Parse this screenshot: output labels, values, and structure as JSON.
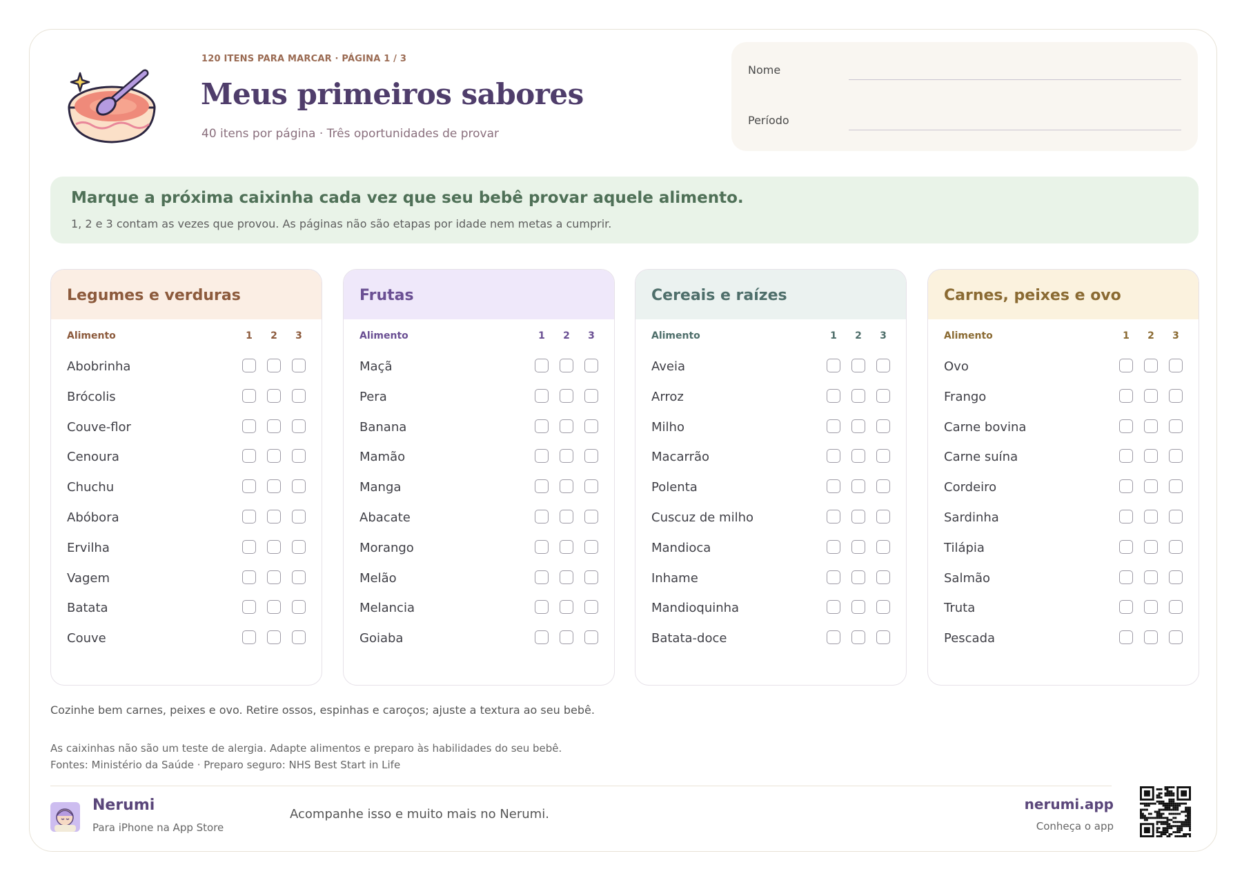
{
  "header": {
    "kicker": "120 ITENS PARA MARCAR · PÁGINA 1 / 3",
    "title": "Meus primeiros sabores",
    "subtitle": "40 itens por página · Três oportunidades de provar",
    "logo_icon": "bowl-with-spoon-icon"
  },
  "form": {
    "name_label": "Nome",
    "period_label": "Período"
  },
  "instructions": {
    "heading": "Marque a próxima caixinha cada vez que seu bebê provar aquele alimento.",
    "detail": "1, 2 e 3 contam as vezes que provou. As páginas não são etapas por idade nem metas a cumprir."
  },
  "columns": {
    "food": "Alimento",
    "n1": "1",
    "n2": "2",
    "n3": "3"
  },
  "categories": [
    {
      "title": "Legumes e verduras",
      "head_bg": "#fbeee4",
      "accent": "#8c5a3c",
      "items": [
        "Abobrinha",
        "Brócolis",
        "Couve-flor",
        "Cenoura",
        "Chuchu",
        "Abóbora",
        "Ervilha",
        "Vagem",
        "Batata",
        "Couve"
      ]
    },
    {
      "title": "Frutas",
      "head_bg": "#efe8fa",
      "accent": "#6a4f93",
      "items": [
        "Maçã",
        "Pera",
        "Banana",
        "Mamão",
        "Manga",
        "Abacate",
        "Morango",
        "Melão",
        "Melancia",
        "Goiaba"
      ]
    },
    {
      "title": "Cereais e raízes",
      "head_bg": "#ebf2f0",
      "accent": "#4e6e6a",
      "items": [
        "Aveia",
        "Arroz",
        "Milho",
        "Macarrão",
        "Polenta",
        "Cuscuz de milho",
        "Mandioca",
        "Inhame",
        "Mandioquinha",
        "Batata-doce"
      ]
    },
    {
      "title": "Carnes, peixes e ovo",
      "head_bg": "#fbf2de",
      "accent": "#8a6a32",
      "items": [
        "Ovo",
        "Frango",
        "Carne bovina",
        "Carne suína",
        "Cordeiro",
        "Sardinha",
        "Tilápia",
        "Salmão",
        "Truta",
        "Pescada"
      ]
    }
  ],
  "notes": {
    "safety": "Cozinhe bem carnes, peixes e ovo. Retire ossos, espinhas e caroços; ajuste a textura ao seu bebê.",
    "allergy": "As caixinhas não são um teste de alergia. Adapte alimentos e preparo às habilidades do seu bebê.",
    "sources": "Fontes: Ministério da Saúde · Preparo seguro: NHS Best Start in Life"
  },
  "footer": {
    "brand": "Nerumi",
    "brand_sub": "Para iPhone na App Store",
    "tagline": "Acompanhe isso e muito mais no Nerumi.",
    "site": "nerumi.app",
    "site_sub": "Conheça o app",
    "avatar_icon": "baby-avatar-icon",
    "qr_icon": "qr-code-icon"
  }
}
